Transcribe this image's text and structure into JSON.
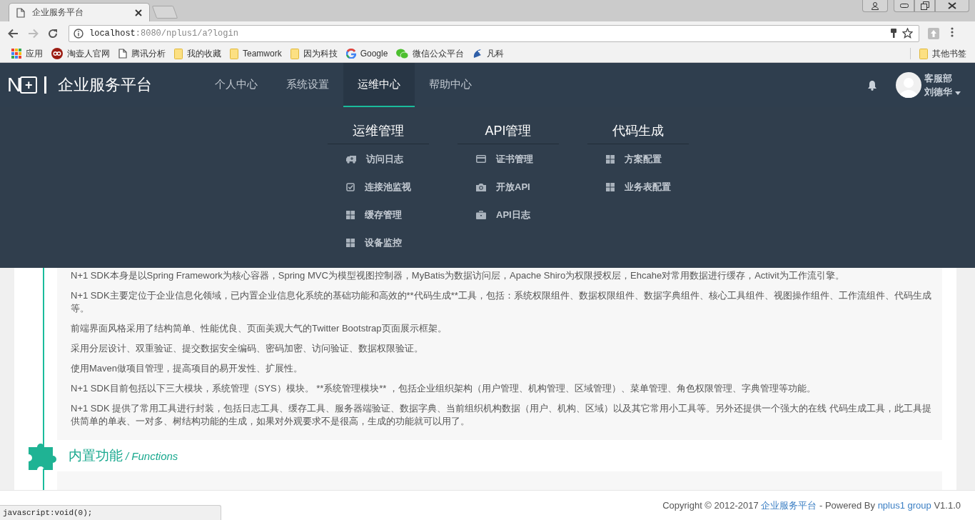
{
  "browser": {
    "tab_title": "企业服务平台",
    "url_host": "localhost",
    "url_rest": ":8080/nplus1/a?login",
    "bookmarks": [
      {
        "label": "应用",
        "kind": "apps"
      },
      {
        "label": "淘壶人官网",
        "kind": "badge"
      },
      {
        "label": "腾讯分析",
        "kind": "page"
      },
      {
        "label": "我的收藏",
        "kind": "folder"
      },
      {
        "label": "Teamwork",
        "kind": "folder"
      },
      {
        "label": "因为科技",
        "kind": "folder"
      },
      {
        "label": "Google",
        "kind": "ring"
      },
      {
        "label": "微信公众平台",
        "kind": "chat"
      },
      {
        "label": "凡科",
        "kind": "swirl"
      }
    ],
    "other_bookmarks": "其他书签",
    "status_url": "javascript:void(0);"
  },
  "header": {
    "logo_letter": "N",
    "logo_sign": "+",
    "brand": "企业服务平台",
    "nav": [
      {
        "label": "个人中心",
        "selected": false
      },
      {
        "label": "系统设置",
        "selected": false
      },
      {
        "label": "运维中心",
        "selected": true
      },
      {
        "label": "帮助中心",
        "selected": false
      }
    ],
    "user": {
      "department": "客服部",
      "name": "刘德华"
    }
  },
  "mega_menu": [
    {
      "title": "运维管理",
      "items": [
        {
          "label": "访问日志",
          "kind": "truck"
        },
        {
          "label": "连接池监视",
          "kind": "check"
        },
        {
          "label": "缓存管理",
          "kind": "grid"
        },
        {
          "label": "设备监控",
          "kind": "grid"
        }
      ]
    },
    {
      "title": "API管理",
      "items": [
        {
          "label": "证书管理",
          "kind": "card"
        },
        {
          "label": "开放API",
          "kind": "camera"
        },
        {
          "label": "API日志",
          "kind": "briefcase"
        }
      ]
    },
    {
      "title": "代码生成",
      "items": [
        {
          "label": "方案配置",
          "kind": "grid"
        },
        {
          "label": "业务表配置",
          "kind": "grid"
        }
      ]
    }
  ],
  "content": {
    "sections": [
      {
        "paragraphs": [
          "N+1 SDK本身是以Spring Framework为核心容器，Spring MVC为模型视图控制器，MyBatis为数据访问层，Apache Shiro为权限授权层，Ehcahe对常用数据进行缓存，Activit为工作流引擎。",
          "N+1 SDK主要定位于企业信息化领域，已内置企业信息化系统的基础功能和高效的**代码生成**工具，包括：系统权限组件、数据权限组件、数据字典组件、核心工具组件、视图操作组件、工作流组件、代码生成等。",
          "前端界面风格采用了结构简单、性能优良、页面美观大气的Twitter Bootstrap页面展示框架。",
          "采用分层设计、双重验证、提交数据安全编码、密码加密、访问验证、数据权限验证。",
          "使用Maven做项目管理，提高项目的易开发性、扩展性。",
          "N+1 SDK目前包括以下三大模块，系统管理（SYS）模块。 **系统管理模块** ，包括企业组织架构（用户管理、机构管理、区域管理）、菜单管理、角色权限管理、字典管理等功能。",
          "N+1 SDK 提供了常用工具进行封装，包括日志工具、缓存工具、服务器端验证、数据字典、当前组织机构数据（用户、机构、区域）以及其它常用小工具等。另外还提供一个强大的在线 代码生成工具，此工具提供简单的单表、一对多、树结构功能的生成，如果对外观要求不是很高，生成的功能就可以用了。"
        ]
      },
      {
        "title": "内置功能",
        "subtitle": "/ Functions",
        "kind": "puzzle"
      }
    ]
  },
  "footer": [
    {
      "kind": "text",
      "text": "Copyright © 2012-2017 "
    },
    {
      "kind": "link",
      "text": "企业服务平台"
    },
    {
      "kind": "text",
      "text": " - Powered By "
    },
    {
      "kind": "link",
      "text": "nplus1 group"
    },
    {
      "kind": "text",
      "text": " V1.1.0"
    }
  ]
}
